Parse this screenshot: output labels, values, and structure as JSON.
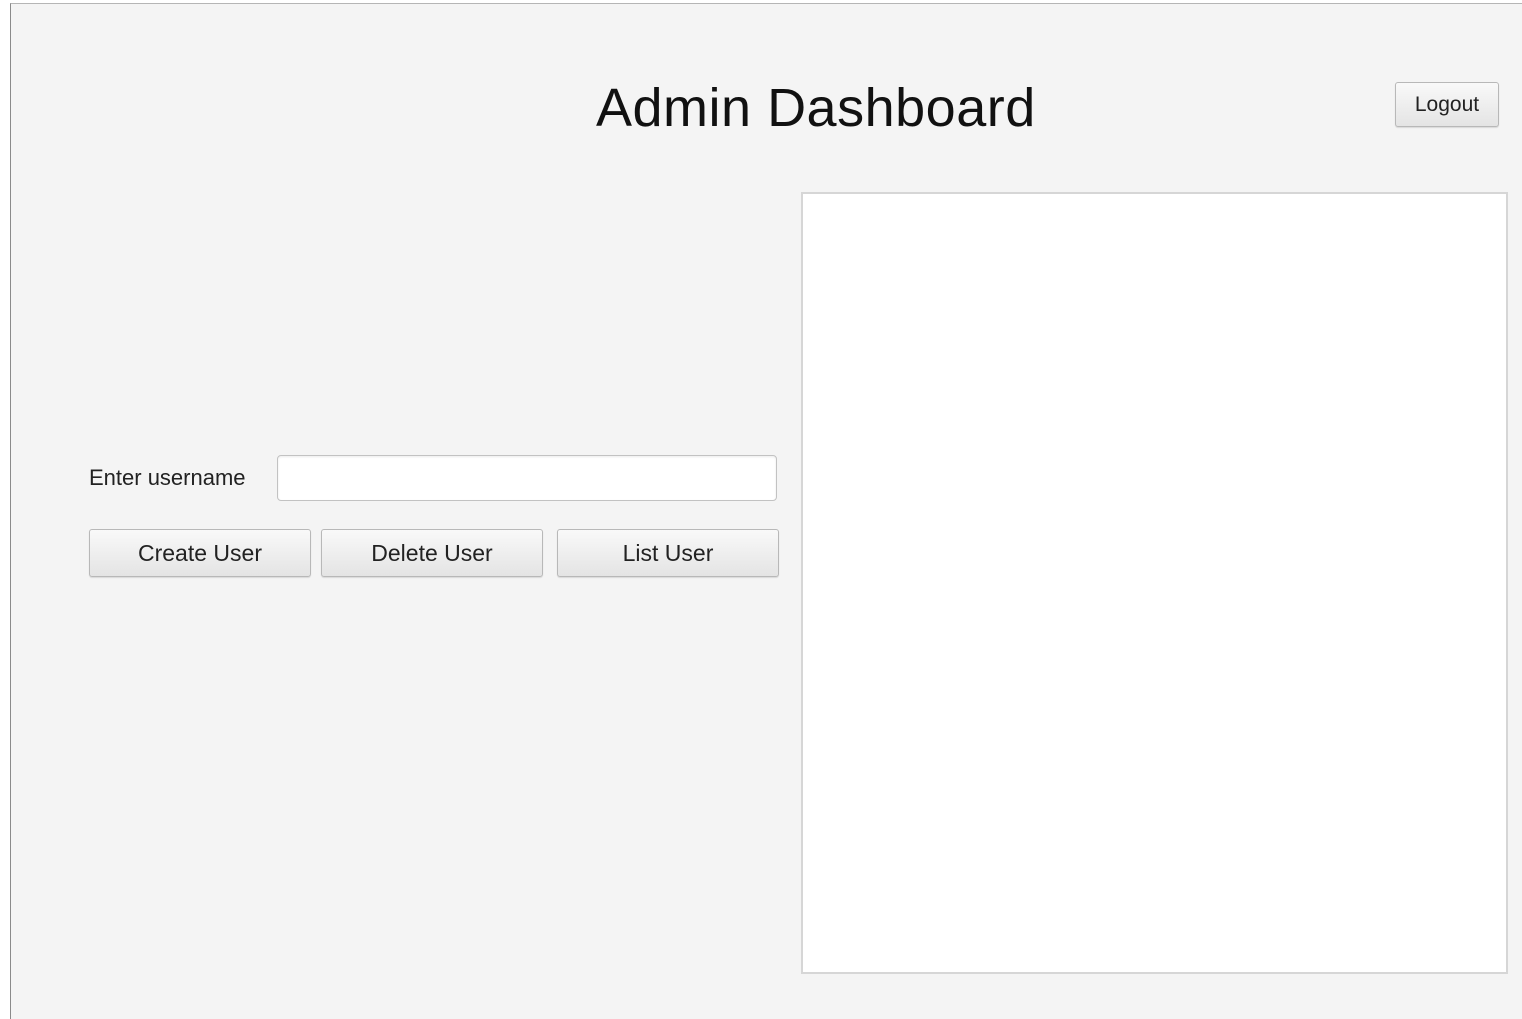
{
  "header": {
    "title": "Admin Dashboard",
    "logout_label": "Logout"
  },
  "form": {
    "username_label": "Enter username",
    "username_value": "",
    "create_label": "Create User",
    "delete_label": "Delete User",
    "list_label": "List User"
  },
  "output": {
    "content": ""
  }
}
